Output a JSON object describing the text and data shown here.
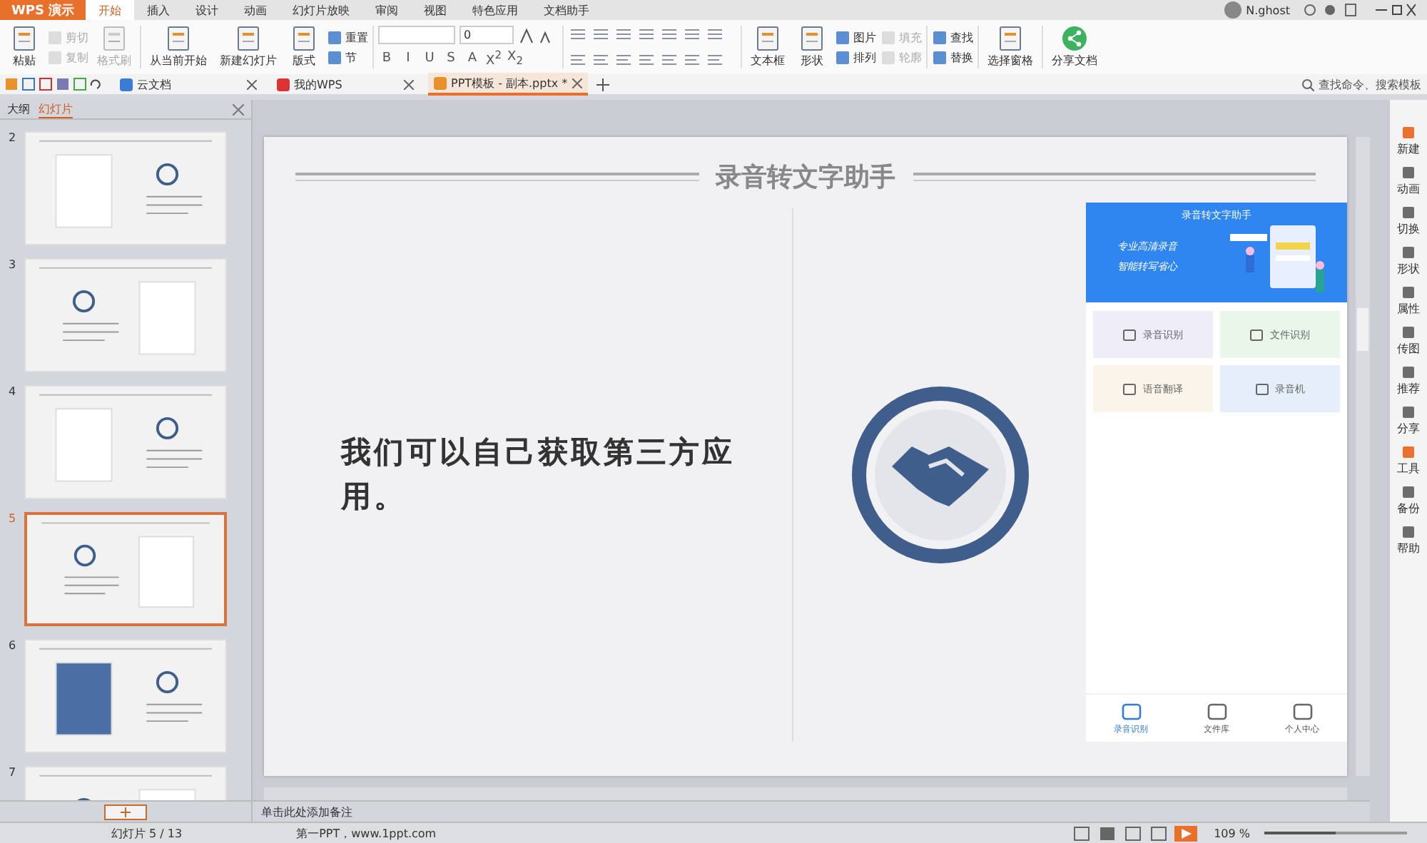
{
  "app_button": {
    "label": "WPS 演示"
  },
  "menu_tabs": [
    {
      "label": "开始",
      "selected": true
    },
    {
      "label": "插入",
      "selected": false
    },
    {
      "label": "设计",
      "selected": false
    },
    {
      "label": "动画",
      "selected": false
    },
    {
      "label": "幻灯片放映",
      "selected": false
    },
    {
      "label": "审阅",
      "selected": false
    },
    {
      "label": "视图",
      "selected": false
    },
    {
      "label": "特色应用",
      "selected": false
    },
    {
      "label": "文档助手",
      "selected": false
    }
  ],
  "user": {
    "name": "N.ghost"
  },
  "ribbon": [
    {
      "kind": "large",
      "label": "粘贴",
      "disabled": false
    },
    {
      "kind": "stack",
      "items": [
        {
          "label": "剪切",
          "disabled": true
        },
        {
          "label": "复制",
          "disabled": true
        }
      ]
    },
    {
      "kind": "large",
      "label": "格式刷",
      "disabled": true
    },
    {
      "kind": "sep"
    },
    {
      "kind": "large",
      "label": "从当前开始",
      "disabled": false
    },
    {
      "kind": "large",
      "label": "新建幻灯片",
      "disabled": false
    },
    {
      "kind": "large",
      "label": "版式",
      "disabled": false
    },
    {
      "kind": "stack",
      "items": [
        {
          "label": "重置",
          "disabled": false
        },
        {
          "label": "节",
          "disabled": false
        }
      ]
    },
    {
      "kind": "sep"
    },
    {
      "kind": "font"
    },
    {
      "kind": "sep"
    },
    {
      "kind": "paragraph"
    },
    {
      "kind": "sep"
    },
    {
      "kind": "large",
      "label": "文本框",
      "disabled": false
    },
    {
      "kind": "large",
      "label": "形状",
      "disabled": false
    },
    {
      "kind": "stack",
      "items": [
        {
          "label": "图片",
          "disabled": false
        },
        {
          "label": "排列",
          "disabled": false
        }
      ]
    },
    {
      "kind": "stack",
      "items": [
        {
          "label": "填充",
          "disabled": true
        },
        {
          "label": "轮廓",
          "disabled": true
        }
      ]
    },
    {
      "kind": "sep"
    },
    {
      "kind": "stack",
      "items": [
        {
          "label": "查找",
          "disabled": false
        },
        {
          "label": "替换",
          "disabled": false
        }
      ]
    },
    {
      "kind": "sep"
    },
    {
      "kind": "large",
      "label": "选择窗格",
      "disabled": false
    },
    {
      "kind": "sep"
    },
    {
      "kind": "share",
      "label": "分享文档",
      "disabled": false
    }
  ],
  "font_size": {
    "value": "0"
  },
  "format_buttons": [
    "B",
    "I",
    "U",
    "S",
    "A",
    "X$^{2}$",
    "X$_{2}$"
  ],
  "doc_tabs": [
    {
      "label": "云文档",
      "selected": false
    },
    {
      "label": "我的WPS",
      "selected": false
    },
    {
      "label": "PPT模板 - 副本.pptx *",
      "selected": true
    }
  ],
  "search": {
    "placeholder": "查找命令、搜索模板"
  },
  "panel_tabs": [
    {
      "label": "大纲",
      "selected": false
    },
    {
      "label": "幻灯片",
      "selected": true
    }
  ],
  "thumbnails": [
    {
      "number": "2",
      "selected": false
    },
    {
      "number": "3",
      "selected": false
    },
    {
      "number": "4",
      "selected": false
    },
    {
      "number": "5",
      "selected": true
    },
    {
      "number": "6",
      "selected": false
    },
    {
      "number": "7",
      "selected": false
    }
  ],
  "slide": {
    "title": "录音转文字助手",
    "body": "我们可以自己获取第三方应用。",
    "phone": {
      "header": "录音转文字助手",
      "slogans": [
        "专业高清录音",
        "智能转写省心"
      ],
      "cards": [
        {
          "label": "录音识别",
          "color": "#eeedf8"
        },
        {
          "label": "文件识别",
          "color": "#eaf6ea"
        },
        {
          "label": "语音翻译",
          "color": "#faf4ea"
        },
        {
          "label": "录音机",
          "color": "#e6eef9"
        }
      ],
      "nav": [
        {
          "label": "录音识别",
          "selected": true
        },
        {
          "label": "文件库",
          "selected": false
        },
        {
          "label": "个人中心",
          "selected": false
        }
      ]
    }
  },
  "sidebar": [
    {
      "label": "新建"
    },
    {
      "label": "动画"
    },
    {
      "label": "切换"
    },
    {
      "label": "形状"
    },
    {
      "label": "属性"
    },
    {
      "label": "传图"
    },
    {
      "label": "推荐"
    },
    {
      "label": "分享"
    },
    {
      "label": "工具"
    },
    {
      "label": "备份"
    },
    {
      "label": "帮助"
    }
  ],
  "notes": {
    "placeholder": "单击此处添加备注"
  },
  "status_bar": {
    "slide_counter": "幻灯片 5 / 13",
    "theme": "第一PPT，www.1ppt.com",
    "zoom": {
      "reading": "109 %",
      "level": 0.5
    }
  }
}
